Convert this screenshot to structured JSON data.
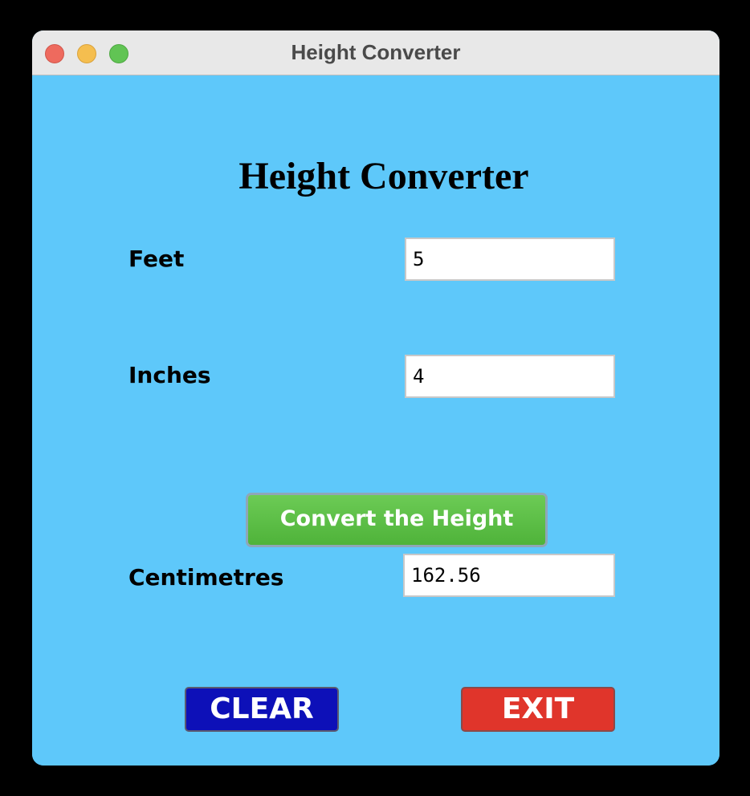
{
  "window": {
    "title": "Height Converter"
  },
  "form": {
    "heading": "Height Converter",
    "feet_label": "Feet",
    "feet_value": "5",
    "inches_label": "Inches",
    "inches_value": "4",
    "convert_label": "Convert the Height",
    "cm_label": "Centimetres",
    "cm_value": "162.56",
    "clear_label": "CLEAR",
    "exit_label": "EXIT"
  },
  "colors": {
    "background": "#5ec8fa",
    "convert_button": "#57bc40",
    "clear_button": "#0d10b8",
    "exit_button": "#e0352b"
  },
  "icons": [
    "close-window-icon",
    "minimize-window-icon",
    "maximize-window-icon"
  ]
}
